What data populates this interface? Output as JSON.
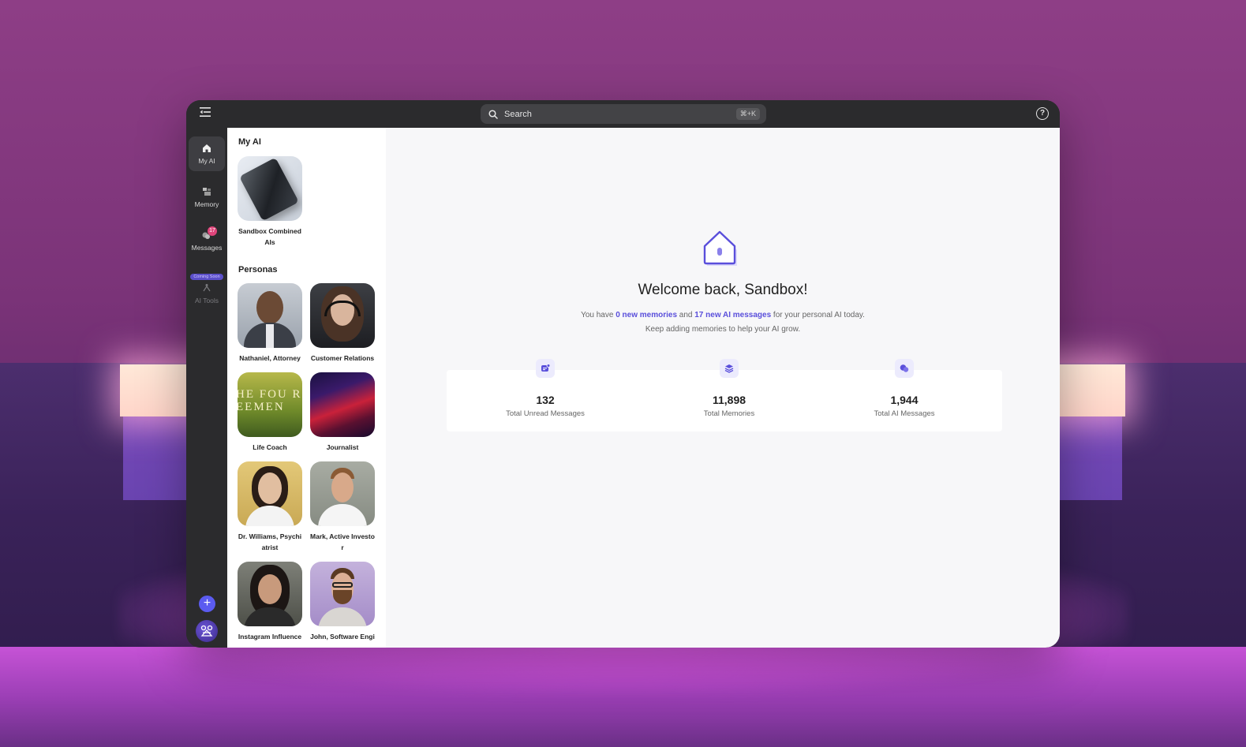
{
  "topbar": {
    "search_placeholder": "Search",
    "search_shortcut": "⌘+K"
  },
  "rail": {
    "items": [
      {
        "label": "My AI",
        "icon": "home-icon",
        "active": true
      },
      {
        "label": "Memory",
        "icon": "memory-icon"
      },
      {
        "label": "Messages",
        "icon": "messages-icon",
        "badge": "17"
      },
      {
        "label": "AI Tools",
        "icon": "ai-tools-icon",
        "pill": "Coming Soon",
        "disabled": true
      }
    ]
  },
  "panel": {
    "my_ai_title": "My AI",
    "my_ai_items": [
      {
        "name": "Sandbox Combined AIs"
      }
    ],
    "personas_title": "Personas",
    "personas": [
      {
        "name": "Nathaniel, Attorney"
      },
      {
        "name": "Customer Relations"
      },
      {
        "name": "Life Coach",
        "cover_text": "HE FOU REEMEN"
      },
      {
        "name": "Journalist"
      },
      {
        "name": "Dr. Williams, Psychiatrist"
      },
      {
        "name": "Mark, Active Investor"
      },
      {
        "name": "Instagram Influence"
      },
      {
        "name": "John, Software Engi"
      }
    ]
  },
  "main": {
    "welcome": "Welcome back, Sandbox!",
    "sub_prefix": "You have ",
    "sub_memories": "0 new memories",
    "sub_and": " and ",
    "sub_messages": "17 new AI messages",
    "sub_suffix": " for your personal AI today.",
    "sub_line2": "Keep adding memories to help your AI grow.",
    "stats": [
      {
        "value": "132",
        "label": "Total Unread Messages",
        "icon": "unread-messages-icon"
      },
      {
        "value": "11,898",
        "label": "Total Memories",
        "icon": "layers-icon"
      },
      {
        "value": "1,944",
        "label": "Total AI Messages",
        "icon": "chat-bubbles-icon"
      }
    ]
  },
  "colors": {
    "accent": "#5a4fdb",
    "rail_bg": "#2b2b2d",
    "badge": "#e0457b"
  }
}
